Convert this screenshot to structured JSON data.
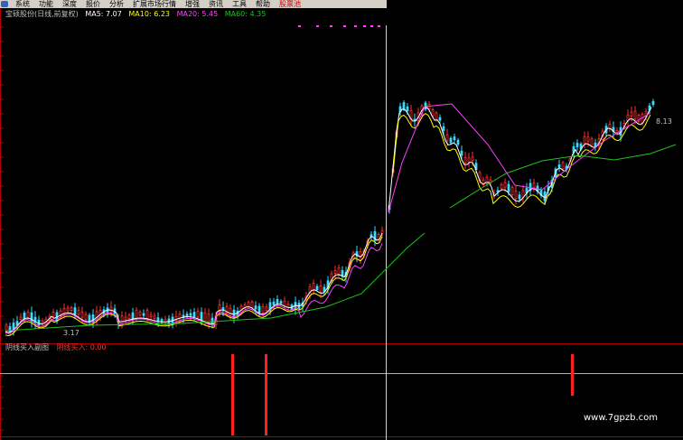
{
  "menu": [
    {
      "label": "系统",
      "highlight": false
    },
    {
      "label": "功能",
      "highlight": false
    },
    {
      "label": "深度",
      "highlight": false
    },
    {
      "label": "报价",
      "highlight": false
    },
    {
      "label": "分析",
      "highlight": false
    },
    {
      "label": "扩展市场行情",
      "highlight": false
    },
    {
      "label": "增强",
      "highlight": false
    },
    {
      "label": "资讯",
      "highlight": false
    },
    {
      "label": "工具",
      "highlight": false
    },
    {
      "label": "帮助",
      "highlight": false
    },
    {
      "label": "股票池",
      "highlight": true
    }
  ],
  "ma_header": {
    "title": "宝硕股份(日线,前复权)",
    "ma5": "MA5: 7.07",
    "ma10": "MA10: 6.23",
    "ma20": "MA20: 5.45",
    "ma60": "MA60: 4.35"
  },
  "sub_header": {
    "title": "阴线买入副图",
    "indicator": "阴线买入: 0.00"
  },
  "annotations": {
    "low_price": "3.17",
    "high_price": "8.13"
  },
  "watermark": "www.7gpzb.com",
  "colors": {
    "up": "#ff3030",
    "down": "#3cd8ff",
    "ma5": "#ffffff",
    "ma10": "#ffff00",
    "ma20": "#ff40ff",
    "ma60": "#20c020",
    "axis": "#b00000",
    "signal": "#ff2020"
  },
  "chart_data": {
    "type": "candlestick",
    "price_range": [
      2.8,
      9.3
    ],
    "series": [
      "MA5",
      "MA10",
      "MA20",
      "MA60"
    ],
    "signals": [
      1,
      1,
      1
    ]
  }
}
